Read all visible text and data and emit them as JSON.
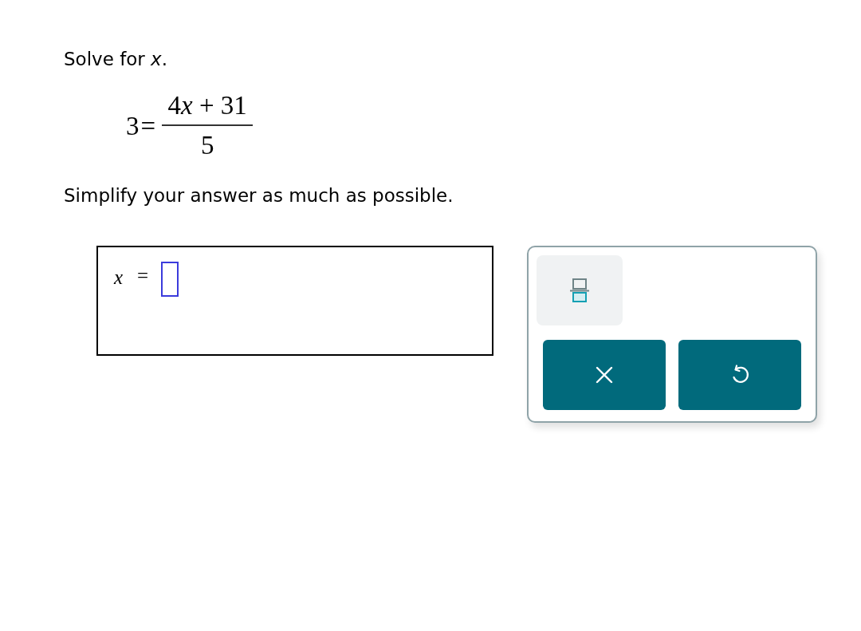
{
  "prompt": "Solve for *x*.",
  "equation": {
    "lhs": "3",
    "relation": "=",
    "numerator": {
      "coefficient": "4",
      "variable": "x",
      "rest": "+ 31"
    },
    "denominator": "5"
  },
  "instruction": "Simplify your answer as much as possible.",
  "answer": {
    "variable": "x",
    "relation": "="
  },
  "tools": [
    {
      "kind": "fraction"
    },
    {
      "kind": "clear"
    },
    {
      "kind": "undo"
    }
  ]
}
